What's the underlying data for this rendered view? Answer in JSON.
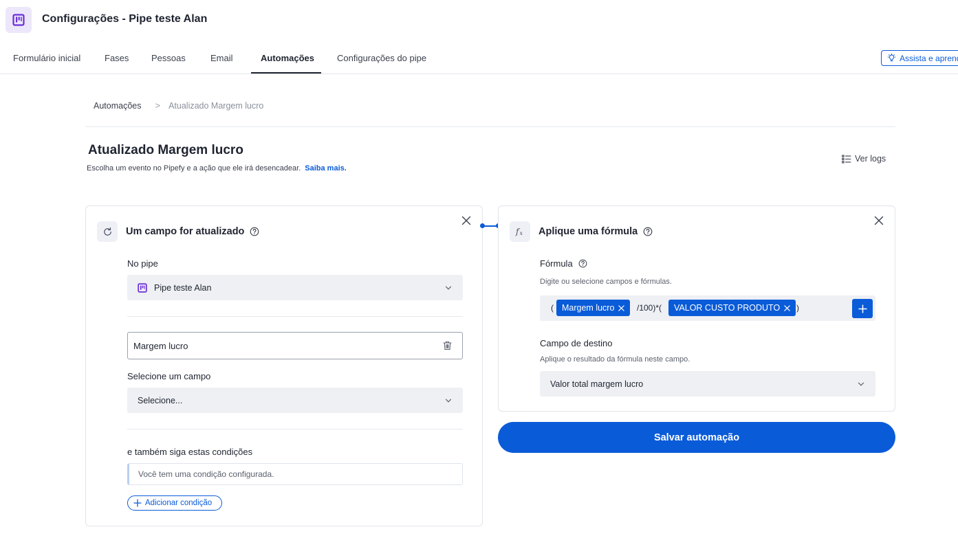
{
  "header": {
    "title": "Configurações - Pipe teste Alan",
    "logo_icon": "kanban-board-icon"
  },
  "tabs": [
    {
      "label": "Formulário inicial",
      "active": false
    },
    {
      "label": "Fases",
      "active": false
    },
    {
      "label": "Pessoas",
      "active": false
    },
    {
      "label": "Email",
      "active": false
    },
    {
      "label": "Automações",
      "active": true
    },
    {
      "label": "Configurações do pipe",
      "active": false
    }
  ],
  "assist": {
    "label": "Assista e aprenda",
    "icon": "lightbulb-icon"
  },
  "breadcrumb": {
    "root": "Automações",
    "separator": ">",
    "current": "Atualizado Margem lucro"
  },
  "automation": {
    "title": "Atualizado Margem lucro",
    "description": "Escolha um evento no Pipefy e a ação que ele irá desencadear.",
    "learn_more": "Saiba mais.",
    "logs_label": "Ver logs"
  },
  "trigger": {
    "title": "Um campo for atualizado",
    "icon": "refresh-icon",
    "pipe_label": "No pipe",
    "pipe_value": "Pipe teste Alan",
    "field_value": "Margem lucro",
    "select_field_label": "Selecione um campo",
    "select_field_placeholder": "Selecione...",
    "conditions_label": "e também siga estas condições",
    "conditions_text": "Você tem uma condição configurada.",
    "add_condition_label": "Adicionar condição"
  },
  "action": {
    "title": "Aplique uma fórmula",
    "icon": "function-icon",
    "formula_label": "Fórmula",
    "formula_hint": "Digite ou selecione campos e fórmulas.",
    "formula": {
      "open1": "(",
      "chip1": "Margem lucro",
      "middle": "/100)*(",
      "chip2": "VALOR CUSTO PRODUTO",
      "close": ")"
    },
    "destination_label": "Campo de destino",
    "destination_hint": "Aplique o resultado da fórmula neste campo.",
    "destination_value": "Valor total margem lucro"
  },
  "save_label": "Salvar automação",
  "colors": {
    "accent": "#0a5bd8",
    "purple": "#6b2fd6",
    "field_bg": "#eef0f4"
  }
}
